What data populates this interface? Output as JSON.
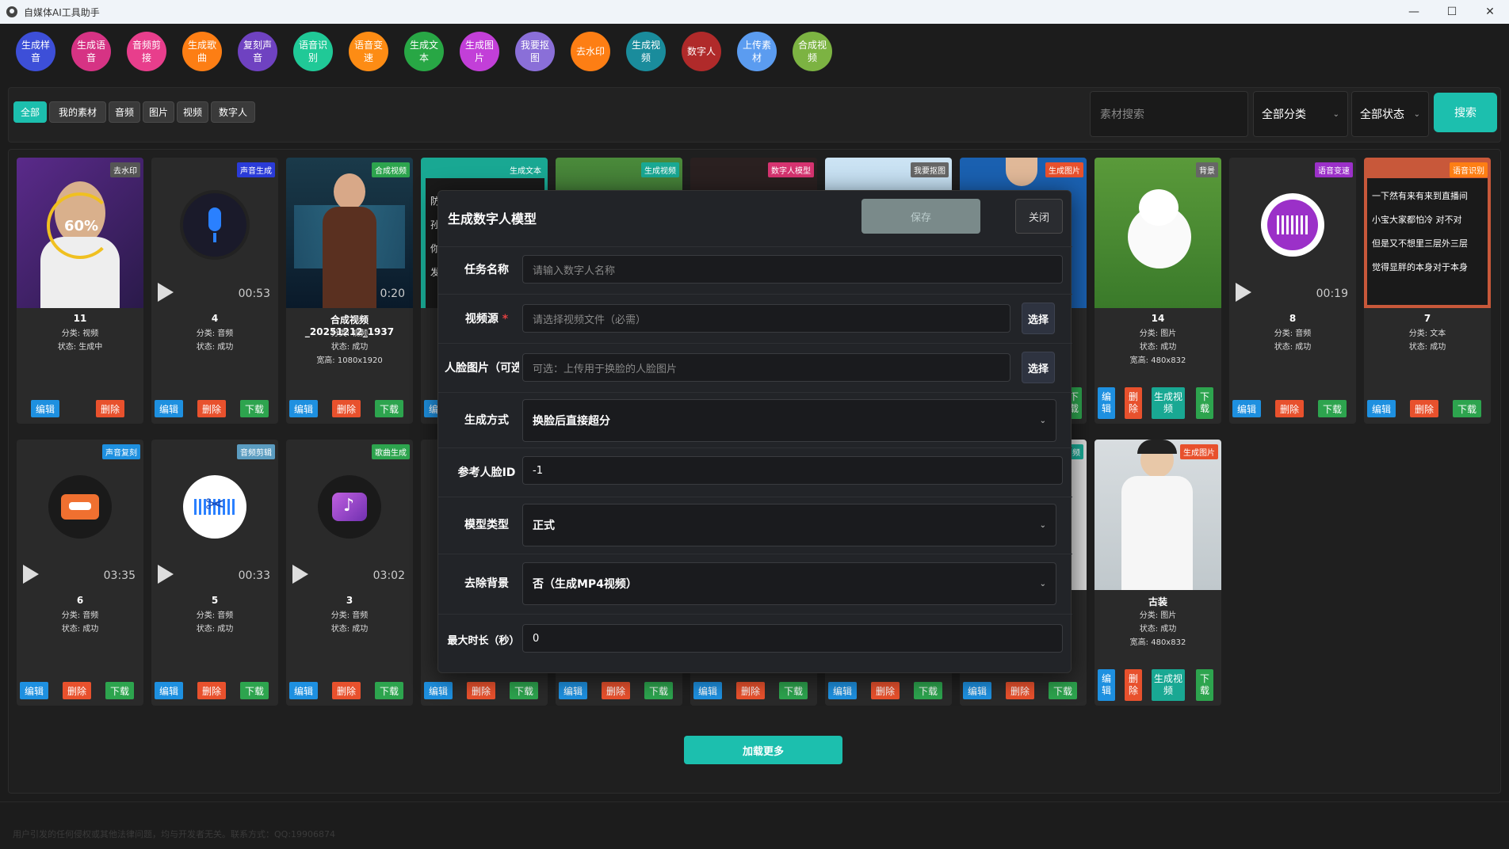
{
  "window": {
    "title": "自媒体AI工具助手",
    "minimize": "—",
    "maximize": "☐",
    "close": "✕"
  },
  "tools": [
    {
      "label": "生成样音",
      "color": "#3d4fd8"
    },
    {
      "label": "生成语音",
      "color": "#d63384"
    },
    {
      "label": "音频剪接",
      "color": "#e83e8c"
    },
    {
      "label": "生成歌曲",
      "color": "#fd7e14"
    },
    {
      "label": "复刻声音",
      "color": "#6f42c1"
    },
    {
      "label": "语音识别",
      "color": "#20c997"
    },
    {
      "label": "语音变速",
      "color": "#fd8c14"
    },
    {
      "label": "生成文本",
      "color": "#28a745"
    },
    {
      "label": "生成图片",
      "color": "#c23fd8"
    },
    {
      "label": "我要抠图",
      "color": "#8a6fd8"
    },
    {
      "label": "去水印",
      "color": "#fd7e14"
    },
    {
      "label": "生成视频",
      "color": "#1a8c9c"
    },
    {
      "label": "数字人",
      "color": "#b02a2a"
    },
    {
      "label": "上传素材",
      "color": "#5b9cf0"
    },
    {
      "label": "合成视频",
      "color": "#7cb342"
    }
  ],
  "filters": {
    "tabs": [
      "全部",
      "我的素材",
      "音频",
      "图片",
      "视频",
      "数字人"
    ],
    "search_placeholder": "素材搜索",
    "category": "全部分类",
    "status": "全部状态",
    "search_button": "搜索"
  },
  "cards_row1": [
    {
      "name": "11",
      "badge": "去水印",
      "badge_color": "#555",
      "info": [
        "分类: 视频",
        "状态: 生成中"
      ],
      "progress": "60%"
    },
    {
      "name": "4",
      "badge": "声音生成",
      "badge_color": "#2a3bd8",
      "info": [
        "分类: 音频",
        "状态: 成功"
      ],
      "duration": "00:53"
    },
    {
      "name": "合成视频_20251212_1937",
      "badge": "合成视频",
      "badge_color": "#2da44e",
      "info": [
        "分类: 视频",
        "状态: 成功",
        "宽高: 1080x1920"
      ],
      "duration": "0:20"
    },
    {
      "badge": "生成文本",
      "badge_color": "#19a893",
      "side_text": [
        "防",
        "孙",
        "你",
        "发"
      ]
    },
    {
      "badge": "生成视频",
      "badge_color": "#19a893"
    },
    {
      "badge": "数字人模型",
      "badge_color": "#d63370"
    },
    {
      "badge": "我要抠图",
      "badge_color": "#666"
    },
    {
      "badge": "生成图片",
      "badge_color": "#e8512d"
    },
    {
      "name": "14",
      "badge": "背景",
      "badge_color": "#666",
      "info": [
        "分类: 图片",
        "状态: 成功",
        "宽高: 480x832"
      ]
    },
    {
      "name": "8",
      "badge": "语音变速",
      "badge_color": "#9b30c8",
      "info": [
        "分类: 音频",
        "状态: 成功"
      ],
      "duration": "00:19"
    },
    {
      "name": "7",
      "badge": "语音识别",
      "badge_color": "#fd7e14",
      "info": [
        "分类: 文本",
        "状态: 成功"
      ],
      "text_lines": [
        "一下然有来有来到直播间",
        "小宝大家都怕冷 对不对",
        "但是又不想里三层外三层",
        "觉得显胖的本身对于本身"
      ]
    }
  ],
  "cards_row2": [
    {
      "name": "6",
      "badge": "声音复刻",
      "badge_color": "#1e90e0",
      "info": [
        "分类: 音频",
        "状态: 成功"
      ],
      "duration": "03:35"
    },
    {
      "name": "5",
      "badge": "音频剪辑",
      "badge_color": "#5b9cc0",
      "info": [
        "分类: 音频",
        "状态: 成功"
      ],
      "duration": "00:33"
    },
    {
      "name": "3",
      "badge": "歌曲生成",
      "badge_color": "#2da44e",
      "info": [
        "分类: 音频",
        "状态: 成功"
      ],
      "duration": "03:02"
    },
    {
      "badge": "频",
      "badge_color": "#19a893"
    },
    {
      "name": "古装",
      "badge": "生成图片",
      "badge_color": "#e8512d",
      "info": [
        "分类: 图片",
        "状态: 成功",
        "宽高: 480x832"
      ]
    }
  ],
  "buttons": {
    "edit": "编辑",
    "delete": "删除",
    "download": "下载",
    "gen_video": "生成视频",
    "edit_v": "编辑",
    "delete_v": "删除",
    "download_v": "下载"
  },
  "load_more": "加载更多",
  "footer": "用户引发的任何侵权或其他法律问题，均与开发者无关。联系方式：QQ:19906874",
  "modal": {
    "title": "生成数字人模型",
    "save": "保存",
    "close": "关闭",
    "fields": {
      "task_name": {
        "label": "任务名称",
        "placeholder": "请输入数字人名称"
      },
      "video_source": {
        "label": "视频源",
        "placeholder": "请选择视频文件（必需）",
        "pick": "选择"
      },
      "face_image": {
        "label": "人脸图片（可选",
        "placeholder": "可选：上传用于换脸的人脸图片",
        "pick": "选择"
      },
      "gen_mode": {
        "label": "生成方式",
        "value": "换脸后直接超分"
      },
      "ref_face_id": {
        "label": "参考人脸ID",
        "value": "-1"
      },
      "model_type": {
        "label": "模型类型",
        "value": "正式"
      },
      "remove_bg": {
        "label": "去除背景",
        "value": "否（生成MP4视频）"
      },
      "max_duration": {
        "label": "最大时长（秒）",
        "value": "0"
      }
    }
  }
}
